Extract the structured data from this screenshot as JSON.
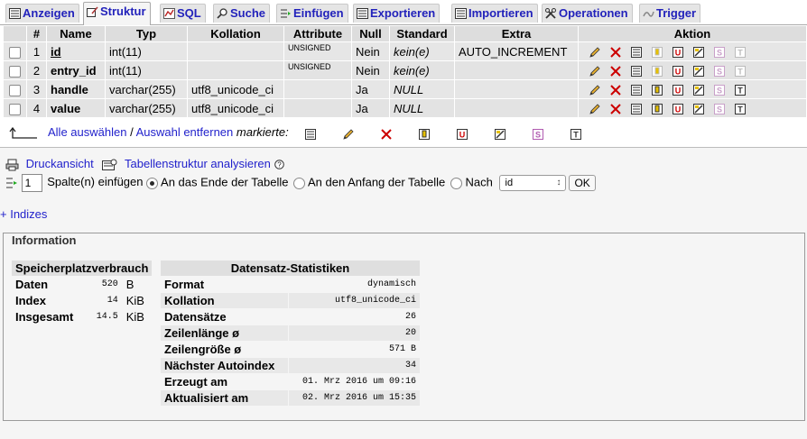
{
  "tabs": [
    {
      "label": "Anzeigen",
      "icon": "browse-icon"
    },
    {
      "label": "Struktur",
      "icon": "structure-icon"
    },
    {
      "label": "SQL",
      "icon": "sql-icon"
    },
    {
      "label": "Suche",
      "icon": "search-icon"
    },
    {
      "label": "Einfügen",
      "icon": "insert-icon"
    },
    {
      "label": "Exportieren",
      "icon": "export-icon"
    },
    {
      "label": "Importieren",
      "icon": "import-icon"
    },
    {
      "label": "Operationen",
      "icon": "tools-icon"
    },
    {
      "label": "Trigger",
      "icon": "trigger-icon"
    }
  ],
  "columns": {
    "hash": "#",
    "name": "Name",
    "type": "Typ",
    "collation": "Kollation",
    "attributes": "Attribute",
    "null": "Null",
    "default": "Standard",
    "extra": "Extra",
    "action": "Aktion"
  },
  "rows": [
    {
      "num": "1",
      "name": "id",
      "type": "int(11)",
      "collation": "",
      "attributes": "UNSIGNED",
      "null": "Nein",
      "default": "kein(e)",
      "extra": "AUTO_INCREMENT"
    },
    {
      "num": "2",
      "name": "entry_id",
      "type": "int(11)",
      "collation": "",
      "attributes": "UNSIGNED",
      "null": "Nein",
      "default": "kein(e)",
      "extra": ""
    },
    {
      "num": "3",
      "name": "handle",
      "type": "varchar(255)",
      "collation": "utf8_unicode_ci",
      "attributes": "",
      "null": "Ja",
      "default": "NULL",
      "extra": ""
    },
    {
      "num": "4",
      "name": "value",
      "type": "varchar(255)",
      "collation": "utf8_unicode_ci",
      "attributes": "",
      "null": "Ja",
      "default": "NULL",
      "extra": ""
    }
  ],
  "selection": {
    "select_all": "Alle auswählen",
    "separator": " / ",
    "deselect_all": "Auswahl entfernen",
    "marked": "markierte:"
  },
  "tools": {
    "print": "Druckansicht",
    "analyze": "Tabellenstruktur analysieren",
    "add_count": "1",
    "add_label": "Spalte(n) einfügen",
    "at_end": "An das Ende der Tabelle",
    "at_start": "An den Anfang der Tabelle",
    "after": "Nach",
    "after_field": "id",
    "ok": "OK"
  },
  "indexes_link": "+ Indizes",
  "info": {
    "legend": "Information",
    "space": {
      "title": "Speicherplatzverbrauch",
      "rows": [
        {
          "label": "Daten",
          "value": "520",
          "unit": "B"
        },
        {
          "label": "Index",
          "value": "14",
          "unit": "KiB"
        },
        {
          "label": "Insgesamt",
          "value": "14.5",
          "unit": "KiB"
        }
      ]
    },
    "stats": {
      "title": "Datensatz-Statistiken",
      "rows": [
        {
          "label": "Format",
          "value": "dynamisch"
        },
        {
          "label": "Kollation",
          "value": "utf8_unicode_ci"
        },
        {
          "label": "Datensätze",
          "value": "26"
        },
        {
          "label": "Zeilenlänge ø",
          "value": "20"
        },
        {
          "label": "Zeilengröße ø",
          "value": "571 B"
        },
        {
          "label": "Nächster Autoindex",
          "value": "34"
        },
        {
          "label": "Erzeugt am",
          "value": "01. Mrz 2016 um 09:16"
        },
        {
          "label": "Aktualisiert am",
          "value": "02. Mrz 2016 um 15:35"
        }
      ]
    }
  }
}
